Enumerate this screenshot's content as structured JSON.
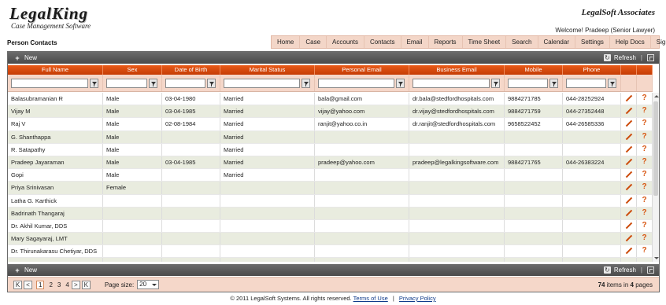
{
  "brand": {
    "logo_main": "LegalKing",
    "logo_sub": "Case Management Software",
    "firm": "LegalSoft Associates",
    "welcome": "Welcome! Pradeep (Senior Lawyer)"
  },
  "page": {
    "title": "Person Contacts"
  },
  "nav": {
    "items": [
      "Home",
      "Case",
      "Accounts",
      "Contacts",
      "Email",
      "Reports",
      "Time Sheet",
      "Search",
      "Calendar",
      "Settings",
      "Help Docs",
      "Sign Out"
    ]
  },
  "toolbar": {
    "new_label": "New",
    "refresh_label": "Refresh",
    "separator": "|"
  },
  "columns": [
    "Full Name",
    "Sex",
    "Date of Birth",
    "Marital Status",
    "Personal Email",
    "Business Email",
    "Mobile",
    "Phone",
    "",
    ""
  ],
  "rows": [
    [
      "Balasubramanian R",
      "Male",
      "03-04-1980",
      "Married",
      "bala@gmail.com",
      "dr.bala@stedfordhospitals.com",
      "9884271785",
      "044-28252924"
    ],
    [
      "Vijay M",
      "Male",
      "03-04-1985",
      "Married",
      "vijay@yahoo.com",
      "dr.vijay@stedfordhospitals.com",
      "9884271759",
      "044-27352448"
    ],
    [
      "Raj V",
      "Male",
      "02-08-1984",
      "Married",
      "ranjit@yahoo.co.in",
      "dr.ranjit@stedfordhospitals.com",
      "9658522452",
      "044-26585336"
    ],
    [
      "G. Shanthappa",
      "Male",
      "",
      "Married",
      "",
      "",
      "",
      ""
    ],
    [
      "R. Satapathy",
      "Male",
      "",
      "Married",
      "",
      "",
      "",
      ""
    ],
    [
      "Pradeep Jayaraman",
      "Male",
      "03-04-1985",
      "Married",
      "pradeep@yahoo.com",
      "pradeep@legalkingsoftware.com",
      "9884271765",
      "044-26383224"
    ],
    [
      "Gopi",
      "Male",
      "",
      "Married",
      "",
      "",
      "",
      ""
    ],
    [
      "Priya Srinivasan",
      "Female",
      "",
      "",
      "",
      "",
      "",
      ""
    ],
    [
      "Latha G. Karthick",
      "",
      "",
      "",
      "",
      "",
      "",
      ""
    ],
    [
      "Badrinath Thangaraj",
      "",
      "",
      "",
      "",
      "",
      "",
      ""
    ],
    [
      "Dr. Akhil Kumar, DDS",
      "",
      "",
      "",
      "",
      "",
      "",
      ""
    ],
    [
      "Mary Sagayaraj, LMT",
      "",
      "",
      "",
      "",
      "",
      "",
      ""
    ],
    [
      "Dr. Thirunakarasu Chetiyar, DDS",
      "",
      "",
      "",
      "",
      "",
      "",
      ""
    ],
    [
      "",
      "",
      "",
      "",
      "",
      "",
      "",
      ""
    ]
  ],
  "pager": {
    "first": "K",
    "prev": "<",
    "next": ">",
    "last": "K",
    "pages": [
      "1",
      "2",
      "3",
      "4"
    ],
    "current_page": "1",
    "size_label": "Page size:",
    "size_value": "20",
    "total_items": "74",
    "items_in": "items in",
    "total_pages": "4",
    "pages_label": "pages"
  },
  "footer": {
    "copyright": "© 2011 LegalSoft Systems. All rights reserved.",
    "terms": "Terms of Use",
    "separator": "|",
    "privacy": "Privacy Policy"
  },
  "colors": {
    "header_orange": "#d9480b",
    "filter_bg": "#f5d7c9",
    "nav_bg": "#f3d6c8",
    "toolbar_grey": "#5a5a5a",
    "alt_row": "#e9ecdf",
    "icon_orange": "#cc4a0a",
    "link_blue": "#0e3a8a"
  },
  "icons": {
    "new": "plus-icon",
    "refresh": "refresh-icon",
    "export": "export-icon",
    "edit": "pencil-icon",
    "help": "question-icon",
    "filter": "funnel-icon"
  }
}
